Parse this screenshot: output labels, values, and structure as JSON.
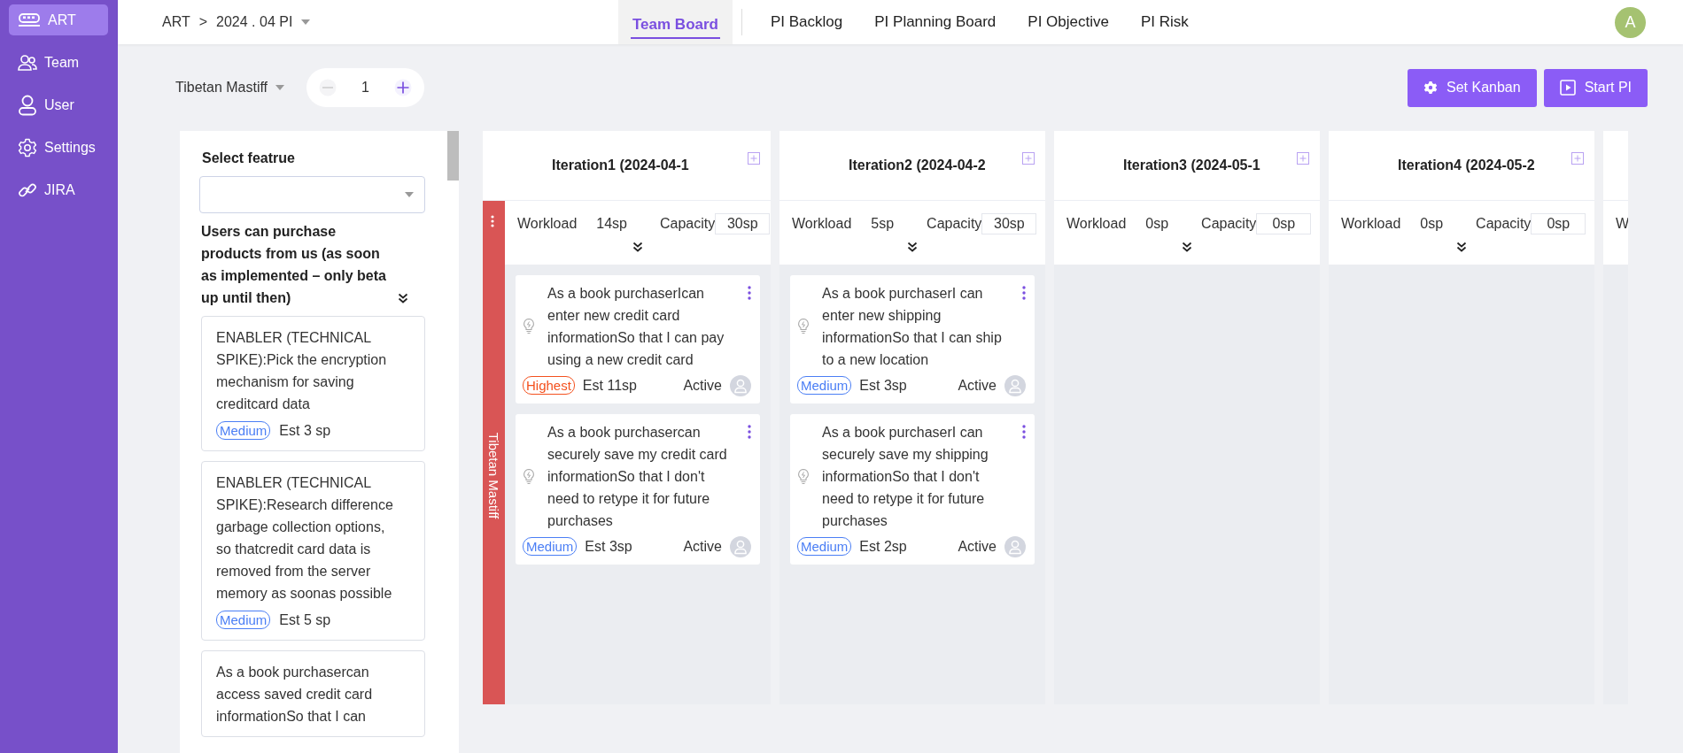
{
  "sidebar": {
    "items": [
      {
        "label": "ART",
        "selected": true
      },
      {
        "label": "Team",
        "selected": false
      },
      {
        "label": "User",
        "selected": false
      },
      {
        "label": "Settings",
        "selected": false
      },
      {
        "label": "JIRA",
        "selected": false
      }
    ]
  },
  "breadcrumb": {
    "root": "ART",
    "separator": ">",
    "current": "2024 . 04 PI"
  },
  "tabs": [
    {
      "label": "Team Board",
      "selected": true
    },
    {
      "label": "PI Backlog",
      "selected": false
    },
    {
      "label": "PI Planning Board",
      "selected": false
    },
    {
      "label": "PI Objective",
      "selected": false
    },
    {
      "label": "PI Risk",
      "selected": false
    }
  ],
  "avatar": "A",
  "toolbar": {
    "team": "Tibetan Mastiff",
    "stepper_value": "1",
    "buttons": [
      {
        "label": "Set Kanban"
      },
      {
        "label": "Start PI"
      }
    ]
  },
  "feature_panel": {
    "label": "Select featrue",
    "feature_title": "Users can purchase products from us (as soon as implemented – only beta up until then)",
    "cards": [
      {
        "text": "ENABLER (TECHNICAL SPIKE):Pick the encryption mechanism for saving creditcard data",
        "priority": {
          "label": "Medium",
          "color": "#4a7ef5"
        },
        "estimate": "Est 3 sp"
      },
      {
        "text": "ENABLER (TECHNICAL SPIKE):Research difference garbage collection options, so thatcredit card data is removed from the server memory as soonas possible",
        "priority": {
          "label": "Medium",
          "color": "#4a7ef5"
        },
        "estimate": "Est 5 sp"
      },
      {
        "text": "As a book purchasercan access saved credit card informationSo that I can"
      }
    ]
  },
  "lane": {
    "label": "Tibetan Mastiff"
  },
  "columns": [
    {
      "title": "Iteration1 (2024-04-1",
      "workload_label": "Workload",
      "workload": "14sp",
      "capacity_label": "Capacity",
      "capacity": "30sp",
      "cards": [
        {
          "text": "As a book purchaserIcan enter new credit card informationSo that I can pay using a new credit card",
          "priority": {
            "label": "Highest",
            "color": "#f4511e"
          },
          "estimate": "Est 11sp",
          "status": "Active"
        },
        {
          "text": "As a book purchasercan securely save my credit card informationSo that I don't need to retype it for future purchases",
          "priority": {
            "label": "Medium",
            "color": "#4a7ef5"
          },
          "estimate": "Est 3sp",
          "status": "Active"
        }
      ]
    },
    {
      "title": "Iteration2 (2024-04-2",
      "workload_label": "Workload",
      "workload": "5sp",
      "capacity_label": "Capacity",
      "capacity": "30sp",
      "cards": [
        {
          "text": "As a book purchaserI can enter new shipping informationSo that I can ship to a new location",
          "priority": {
            "label": "Medium",
            "color": "#4a7ef5"
          },
          "estimate": "Est 3sp",
          "status": "Active"
        },
        {
          "text": "As a book purchaserI can securely save my shipping informationSo that I don't need to retype it for future purchases",
          "priority": {
            "label": "Medium",
            "color": "#4a7ef5"
          },
          "estimate": "Est 2sp",
          "status": "Active"
        }
      ]
    },
    {
      "title": "Iteration3 (2024-05-1",
      "workload_label": "Workload",
      "workload": "0sp",
      "capacity_label": "Capacity",
      "capacity": "0sp"
    },
    {
      "title": "Iteration4 (2024-05-2",
      "workload_label": "Workload",
      "workload": "0sp",
      "capacity_label": "Capacity",
      "capacity": "0sp"
    },
    {
      "workload_label": "W"
    }
  ]
}
